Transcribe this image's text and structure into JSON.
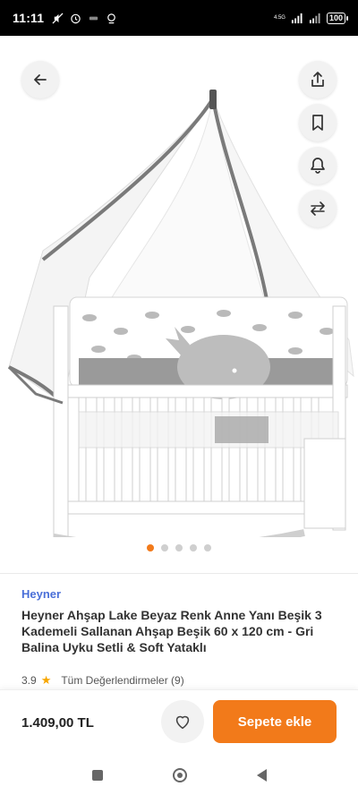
{
  "status_bar": {
    "time": "11:11",
    "network": "4.5G",
    "battery": "100"
  },
  "hero": {
    "image_alt": "Beyaz ahşap beşik, gri balina desenli uyku seti ve cibinlik",
    "dots_count": 5,
    "active_dot": 0
  },
  "icons": {
    "back": "arrow-left-icon",
    "share": "share-icon",
    "bookmark": "bookmark-icon",
    "bell": "bell-icon",
    "compare": "compare-arrows-icon",
    "favorite": "heart-icon"
  },
  "product": {
    "brand": "Heyner",
    "title": "Heyner Ahşap Lake Beyaz Renk Anne Yanı Beşik 3 Kademeli Sallanan Ahşap Beşik 60 x 120 cm - Gri Balina Uyku Setli & Soft Yataklı",
    "rating": "3.9",
    "reviews_label": "Tüm Değerlendirmeler (9)"
  },
  "cart": {
    "price": "1.409,00 TL",
    "add_label": "Sepete ekle"
  },
  "colors": {
    "accent": "#f27a1a",
    "brand_link": "#4a6fd8",
    "star": "#f7a600"
  }
}
